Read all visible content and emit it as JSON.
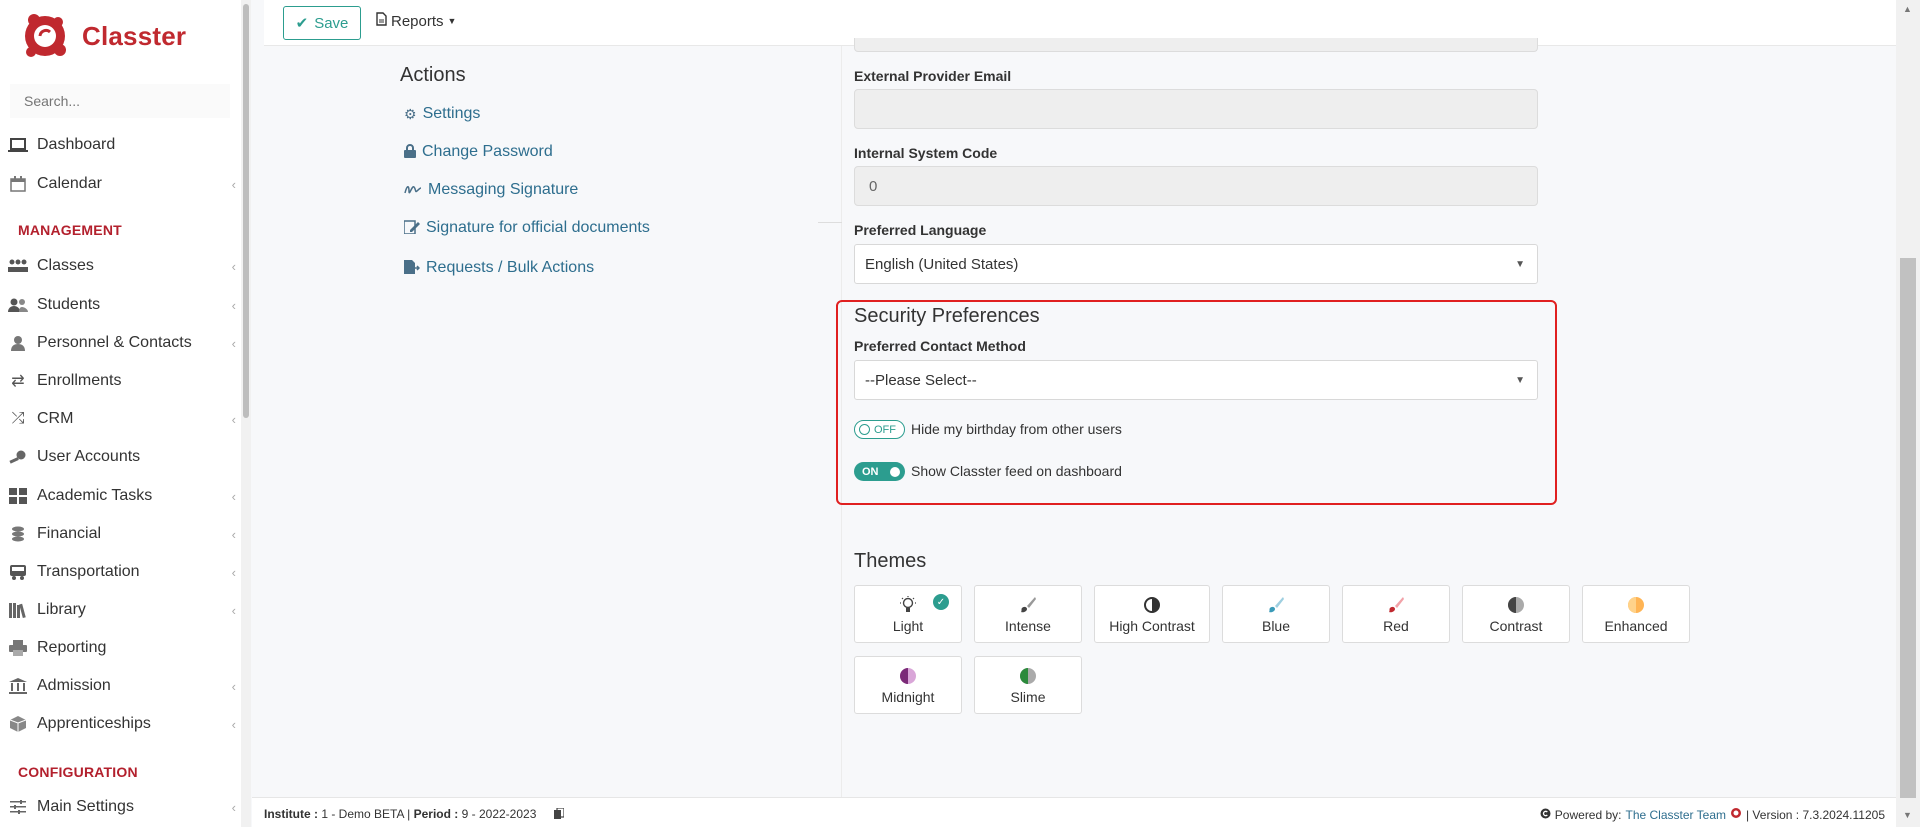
{
  "app": {
    "name": "Classter"
  },
  "sidebar": {
    "search_placeholder": "Search...",
    "items": [
      {
        "label": "Dashboard",
        "icon": "laptop-icon",
        "chevron": false
      },
      {
        "label": "Calendar",
        "icon": "calendar-icon",
        "chevron": true
      }
    ],
    "management_heading": "MANAGEMENT",
    "management_items": [
      {
        "label": "Classes",
        "icon": "classes-icon",
        "chevron": true
      },
      {
        "label": "Students",
        "icon": "students-icon",
        "chevron": true
      },
      {
        "label": "Personnel & Contacts",
        "icon": "person-icon",
        "chevron": true
      },
      {
        "label": "Enrollments",
        "icon": "swap-arrows-icon",
        "chevron": false
      },
      {
        "label": "CRM",
        "icon": "shuffle-icon",
        "chevron": true
      },
      {
        "label": "User Accounts",
        "icon": "key-icon",
        "chevron": false
      },
      {
        "label": "Academic Tasks",
        "icon": "grid-icon",
        "chevron": true
      },
      {
        "label": "Financial",
        "icon": "coins-icon",
        "chevron": true
      },
      {
        "label": "Transportation",
        "icon": "bus-icon",
        "chevron": true
      },
      {
        "label": "Library",
        "icon": "books-icon",
        "chevron": true
      },
      {
        "label": "Reporting",
        "icon": "printer-icon",
        "chevron": false
      },
      {
        "label": "Admission",
        "icon": "institution-icon",
        "chevron": true
      },
      {
        "label": "Apprenticeships",
        "icon": "box-icon",
        "chevron": true
      }
    ],
    "configuration_heading": "CONFIGURATION",
    "configuration_items": [
      {
        "label": "Main Settings",
        "icon": "sliders-icon",
        "chevron": true
      }
    ]
  },
  "toolbar": {
    "save_label": "Save",
    "reports_label": "Reports"
  },
  "actions": {
    "title": "Actions",
    "links": [
      {
        "label": "Settings",
        "icon": "cogs-icon"
      },
      {
        "label": "Change Password",
        "icon": "lock-icon"
      },
      {
        "label": "Messaging Signature",
        "icon": "signature-icon"
      },
      {
        "label": "Signature for official documents",
        "icon": "edit-doc-icon"
      },
      {
        "label": "Requests / Bulk Actions",
        "icon": "export-doc-icon"
      }
    ]
  },
  "form": {
    "external_email_label": "External Provider Email",
    "external_email_value": "",
    "internal_code_label": "Internal System Code",
    "internal_code_value": "0",
    "language_label": "Preferred Language",
    "language_value": "English (United States)"
  },
  "security": {
    "title": "Security Preferences",
    "contact_label": "Preferred Contact Method",
    "contact_value": "--Please Select--",
    "toggle_birthday_state": "OFF",
    "toggle_birthday_label": "Hide my birthday from other users",
    "toggle_feed_state": "ON",
    "toggle_feed_label": "Show Classter feed on dashboard"
  },
  "themes": {
    "title": "Themes",
    "items": [
      {
        "label": "Light",
        "selected": true
      },
      {
        "label": "Intense"
      },
      {
        "label": "High Contrast"
      },
      {
        "label": "Blue"
      },
      {
        "label": "Red"
      },
      {
        "label": "Contrast"
      },
      {
        "label": "Enhanced"
      },
      {
        "label": "Midnight"
      },
      {
        "label": "Slime"
      }
    ]
  },
  "footer": {
    "institute_label": "Institute :",
    "institute_value": "1 - Demo BETA",
    "period_label": "Period :",
    "period_value": "9 - 2022-2023",
    "powered_by": "Powered by:",
    "team_link": "The Classter Team",
    "version": "| Version : 7.3.2024.11205"
  },
  "colors": {
    "brand": "#c0292f",
    "accent": "#2c9d8f",
    "link": "#2e6e8e",
    "highlight": "#e02020"
  }
}
